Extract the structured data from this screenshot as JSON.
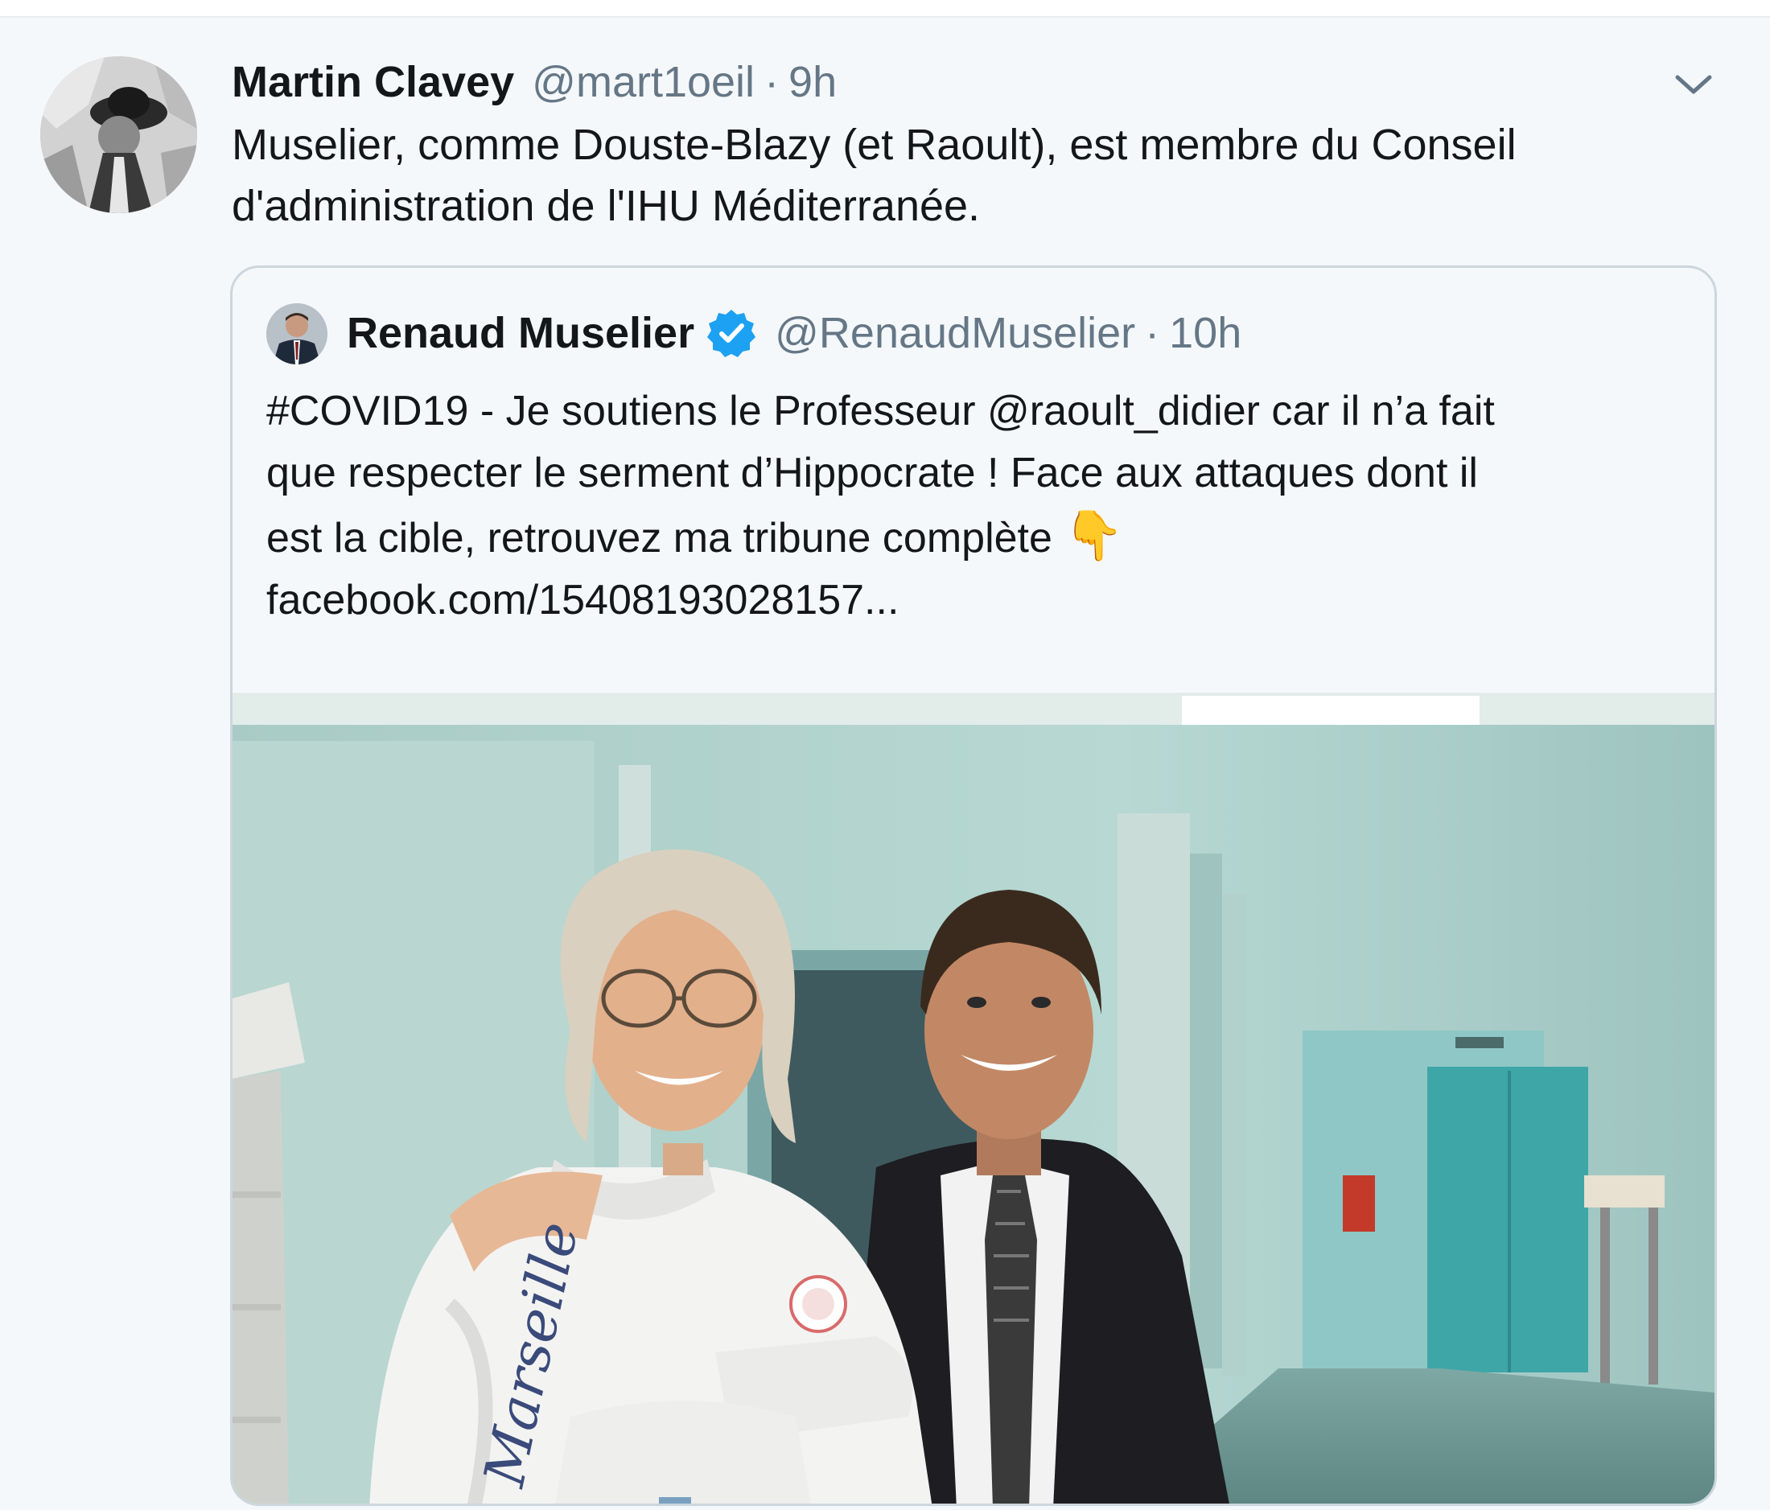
{
  "tweet": {
    "author_name": "Martin Clavey",
    "author_handle": "@mart1oeil",
    "separator": "·",
    "time": "9h",
    "text_lines": [
      "Muselier, comme Douste-Blazy (et Raoult), est membre du Conseil",
      "d'administration de l'IHU Méditerranée."
    ]
  },
  "quoted": {
    "author_name": "Renaud Muselier",
    "author_handle": "@RenaudMuselier",
    "separator": "·",
    "time": "10h",
    "verified_icon": "verified-badge-icon",
    "text_lines": [
      "#COVID19 - Je soutiens le Professeur @raoult_didier car il n’a fait",
      "que respecter le serment d’Hippocrate ! Face aux attaques dont il",
      "est la cible, retrouvez ma tribune complète",
      "facebook.com/15408193028157..."
    ],
    "emoji": "👇",
    "photo_shirt_text": "Marseille"
  },
  "colors": {
    "background": "#f5f8fa",
    "text_primary": "#14171a",
    "text_secondary": "#657786",
    "border": "#ccd6dd",
    "verified": "#1da1f2"
  }
}
